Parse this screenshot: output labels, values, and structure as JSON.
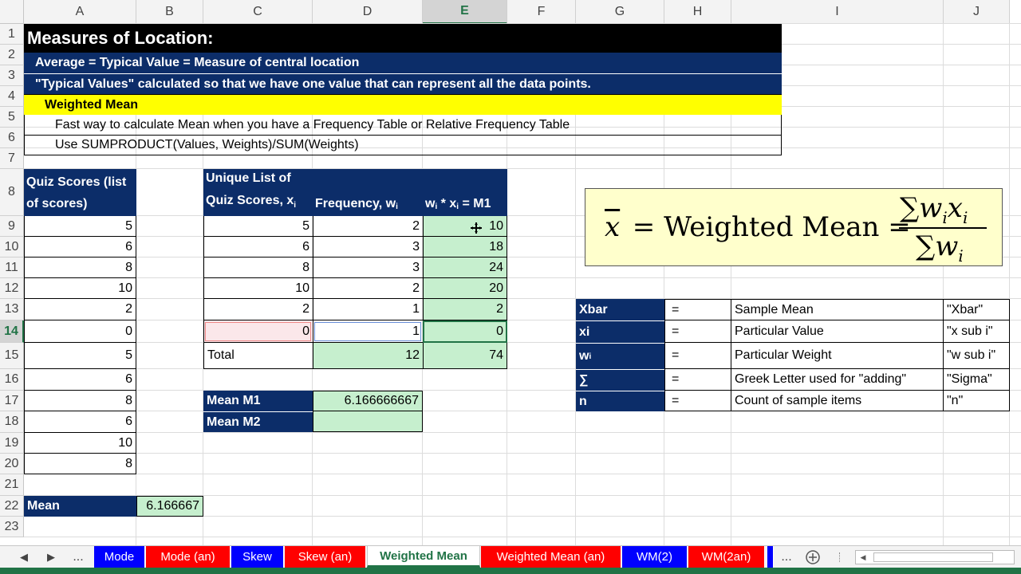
{
  "columns": [
    "A",
    "B",
    "C",
    "D",
    "E",
    "F",
    "G",
    "H",
    "I",
    "J"
  ],
  "rows": [
    "1",
    "2",
    "3",
    "4",
    "5",
    "6",
    "7",
    "8",
    "9",
    "10",
    "11",
    "12",
    "13",
    "14",
    "15",
    "16",
    "17",
    "18",
    "19",
    "20",
    "21",
    "22",
    "23"
  ],
  "header": {
    "title": "Measures of Location:",
    "line2": "Average = Typical Value = Measure of central location",
    "line3": "\"Typical Values\" calculated so that we have one value that can represent all the data points.",
    "line4": "Weighted Mean",
    "line5": "Fast way to calculate Mean when you have a Frequency Table or Relative Frequency Table",
    "line6": "Use SUMPRODUCT(Values, Weights)/SUM(Weights)"
  },
  "quiz_list": {
    "header_line1": "Quiz Scores (list",
    "header_line2": "of scores)",
    "values": [
      "5",
      "6",
      "8",
      "10",
      "2",
      "0",
      "5",
      "6",
      "8",
      "6",
      "10",
      "8"
    ],
    "mean_label": "Mean",
    "mean_value": "6.166667"
  },
  "freq_table": {
    "h1_line1": "Unique List of",
    "h1_line2": "Quiz Scores, x",
    "h1_sub": "i",
    "h2_main": "Frequency, w",
    "h2_sub": "i",
    "h3_w": "w",
    "h3_wsub": "i",
    "h3_mid": " * x",
    "h3_xsub": "i",
    "h3_end": " = M1",
    "rows": [
      {
        "x": "5",
        "w": "2",
        "m": "10"
      },
      {
        "x": "6",
        "w": "3",
        "m": "18"
      },
      {
        "x": "8",
        "w": "3",
        "m": "24"
      },
      {
        "x": "10",
        "w": "2",
        "m": "20"
      },
      {
        "x": "2",
        "w": "1",
        "m": "2"
      },
      {
        "x": "0",
        "w": "1",
        "m": "0"
      }
    ],
    "total_label": "Total",
    "total_w": "12",
    "total_m": "74"
  },
  "means": {
    "m1_label": "Mean M1",
    "m1_value": "6.166666667",
    "m2_label": "Mean M2",
    "m2_value": ""
  },
  "formula": {
    "xbar": "x",
    "eq": " = Weighted Mean = ",
    "sigma": "∑",
    "w": "w",
    "x": "x",
    "sub": "i"
  },
  "legend": [
    {
      "sym": "Xbar",
      "eq": "=",
      "desc": "Sample Mean",
      "say": "\"Xbar\""
    },
    {
      "sym": "xi",
      "eq": "=",
      "desc": "Particular Value",
      "say": "\"x sub i\""
    },
    {
      "sym": "w",
      "symsub": "i",
      "eq": "=",
      "desc": "Particular Weight",
      "say": "\"w sub i\""
    },
    {
      "sym": "∑",
      "eq": "=",
      "desc": "Greek Letter used for \"adding\"",
      "say": "\"Sigma\""
    },
    {
      "sym": "n",
      "eq": "=",
      "desc": "Count of sample items",
      "say": "\"n\""
    }
  ],
  "tabs": [
    {
      "label": "Mode",
      "color": "#0000ff"
    },
    {
      "label": "Mode (an)",
      "color": "#ff0000"
    },
    {
      "label": "Skew",
      "color": "#0000ff"
    },
    {
      "label": "Skew (an)",
      "color": "#ff0000"
    },
    {
      "label": "Weighted Mean",
      "color": "#ffffff",
      "active": true
    },
    {
      "label": "Weighted Mean (an)",
      "color": "#ff0000"
    },
    {
      "label": "WM(2)",
      "color": "#0000ff"
    },
    {
      "label": "WM(2an)",
      "color": "#ff0000"
    }
  ],
  "tabnav": {
    "prev": "◀",
    "next": "▶",
    "more_left": "...",
    "more_right": "...",
    "add": "+"
  },
  "colors": {
    "navy": "#0c2d69",
    "green": "#c6efce",
    "yellow": "#ffff00",
    "excel_green": "#217346"
  }
}
